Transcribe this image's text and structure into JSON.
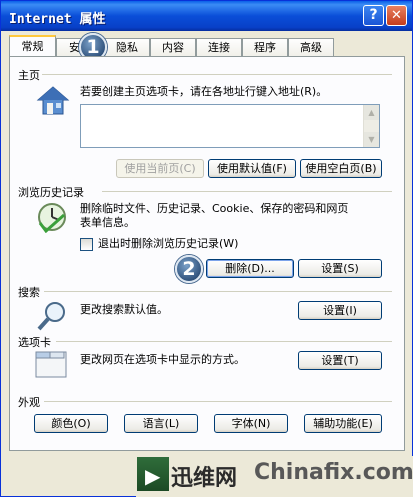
{
  "window": {
    "title": "Internet 属性"
  },
  "titlebar": {
    "help_label": "?",
    "close_label": "✕"
  },
  "tabs": [
    {
      "label": "常规"
    },
    {
      "label": "安全"
    },
    {
      "label": "隐私"
    },
    {
      "label": "内容"
    },
    {
      "label": "连接"
    },
    {
      "label": "程序"
    },
    {
      "label": "高级"
    }
  ],
  "home": {
    "title": "主页",
    "description": "若要创建主页选项卡，请在各地址行键入地址(R)。",
    "address_value": "",
    "use_current": "使用当前页(C)",
    "use_default": "使用默认值(F)",
    "use_blank": "使用空白页(B)"
  },
  "history": {
    "title": "浏览历史记录",
    "description_line1": "删除临时文件、历史记录、Cookie、保存的密码和网页",
    "description_line2": "表单信息。",
    "checkbox_label": "退出时删除浏览历史记录(W)",
    "delete_button": "删除(D)...",
    "settings_button": "设置(S)"
  },
  "search": {
    "title": "搜索",
    "description": "更改搜索默认值。",
    "settings_button": "设置(I)"
  },
  "tabs_section": {
    "title": "选项卡",
    "description": "更改网页在选项卡中显示的方式。",
    "settings_button": "设置(T)"
  },
  "appearance": {
    "title": "外观",
    "colors": "颜色(O)",
    "languages": "语言(L)",
    "fonts": "字体(N)",
    "accessibility": "辅助功能(E)"
  },
  "badges": {
    "first": "1",
    "second": "2"
  },
  "watermark": {
    "cn": "迅维网",
    "en": "Chinafix.com"
  }
}
